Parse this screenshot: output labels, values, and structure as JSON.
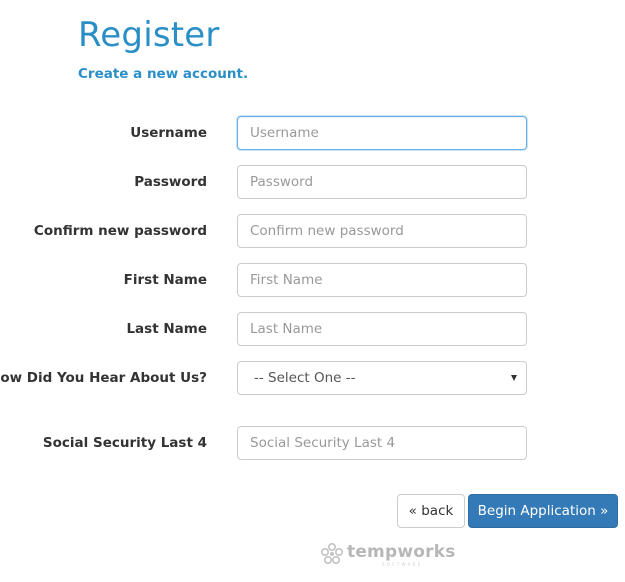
{
  "page": {
    "title": "Register",
    "subtitle": "Create a new account."
  },
  "form": {
    "username": {
      "label": "Username",
      "value": "",
      "placeholder": "Username"
    },
    "password": {
      "label": "Password",
      "value": "",
      "placeholder": "Password"
    },
    "confirm_password": {
      "label": "Confirm new password",
      "value": "",
      "placeholder": "Confirm new password"
    },
    "first_name": {
      "label": "First Name",
      "value": "",
      "placeholder": "First Name"
    },
    "last_name": {
      "label": "Last Name",
      "value": "",
      "placeholder": "Last Name"
    },
    "referral": {
      "label": "How Did You Hear About Us?",
      "selected": "-- Select One --"
    },
    "ssn_last4": {
      "label": "Social Security Last 4",
      "value": "",
      "placeholder": "Social Security Last 4"
    }
  },
  "actions": {
    "back_label": "« back",
    "submit_label": "Begin Application »"
  },
  "logo": {
    "name": "tempworks",
    "tagline": "SOFTWARE",
    "icon": "tempworks-logo-icon"
  },
  "colors": {
    "accent": "#2b8fc7",
    "primary_button": "#337ab7",
    "focus_border": "#66afe9"
  }
}
